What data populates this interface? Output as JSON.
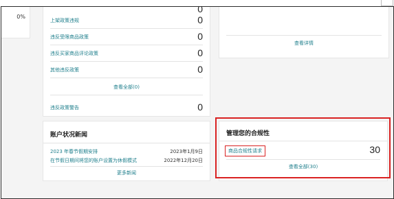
{
  "left_card": {
    "percent": "0%"
  },
  "policy_card": {
    "top_value": "0",
    "rows": [
      {
        "label": "上架政策违规",
        "value": "0"
      },
      {
        "label": "违反受限商品政策",
        "value": "0"
      },
      {
        "label": "违反买家商品评论政策",
        "value": "0"
      },
      {
        "label": "其他违反政策",
        "value": "0"
      }
    ],
    "view_all": "查看全部(0)",
    "warning_row": {
      "label": "违反政策警告",
      "value": "0"
    }
  },
  "right_top_card": {
    "view_details": "查看详情"
  },
  "news_card": {
    "title": "账户状况新闻",
    "items": [
      {
        "title": "2023 年春节假期安排",
        "date": "2023年1月9日"
      },
      {
        "title": "在节假日期间将您的账户设置为休假模式",
        "date": "2022年12月20日"
      }
    ],
    "more": "更多新闻"
  },
  "compliance_card": {
    "title": "管理您的合规性",
    "item_label": "商品合规性请求",
    "item_value": "30",
    "view_all": "查看全部(30)"
  },
  "highlight_color": "#d92121",
  "link_color": "#1f7f8c"
}
